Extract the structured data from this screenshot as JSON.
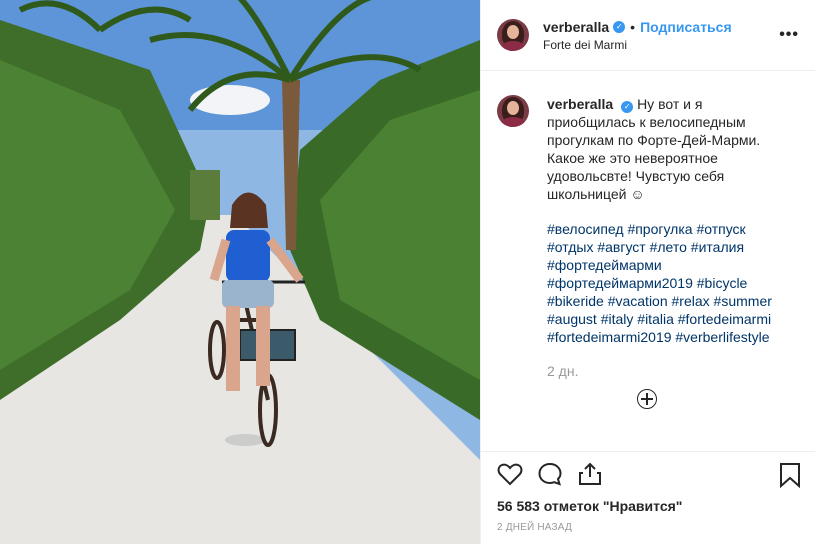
{
  "post": {
    "username": "verberalla",
    "follow_label": "Подписаться",
    "location": "Forte dei Marmi",
    "caption_lines": [
      "Ну вот и я",
      "приобщилась к велосипедным",
      "прогулкам по Форте-Дей-Марми.",
      "Какое же это невероятное",
      "удовольсвте! Чувстую себя",
      "школьницей ☺"
    ],
    "hashtag_lines": [
      "#велосипед #прогулка #отпуск",
      "#отдых #август #лето #италия",
      "#фортедеймарми",
      "#фортедеймарми2019 #bicycle",
      "#bikeride #vacation #relax #summer",
      "#august #italy #italia #fortedeimarmi",
      "#fortedeimarmi2019 #verberlifestyle"
    ],
    "age": "2 дн.",
    "likes": "56 583 отметок \"Нравится\"",
    "date": "2 ДНЕЙ НАЗАД"
  },
  "icons": {
    "verified": "verified-badge-icon",
    "more": "more-options-icon",
    "add": "plus-circle-icon",
    "like": "heart-icon",
    "comment": "comment-icon",
    "share": "share-icon",
    "save": "bookmark-icon"
  },
  "colors": {
    "link": "#3897f0",
    "hashtag": "#003569",
    "muted": "#999999"
  }
}
